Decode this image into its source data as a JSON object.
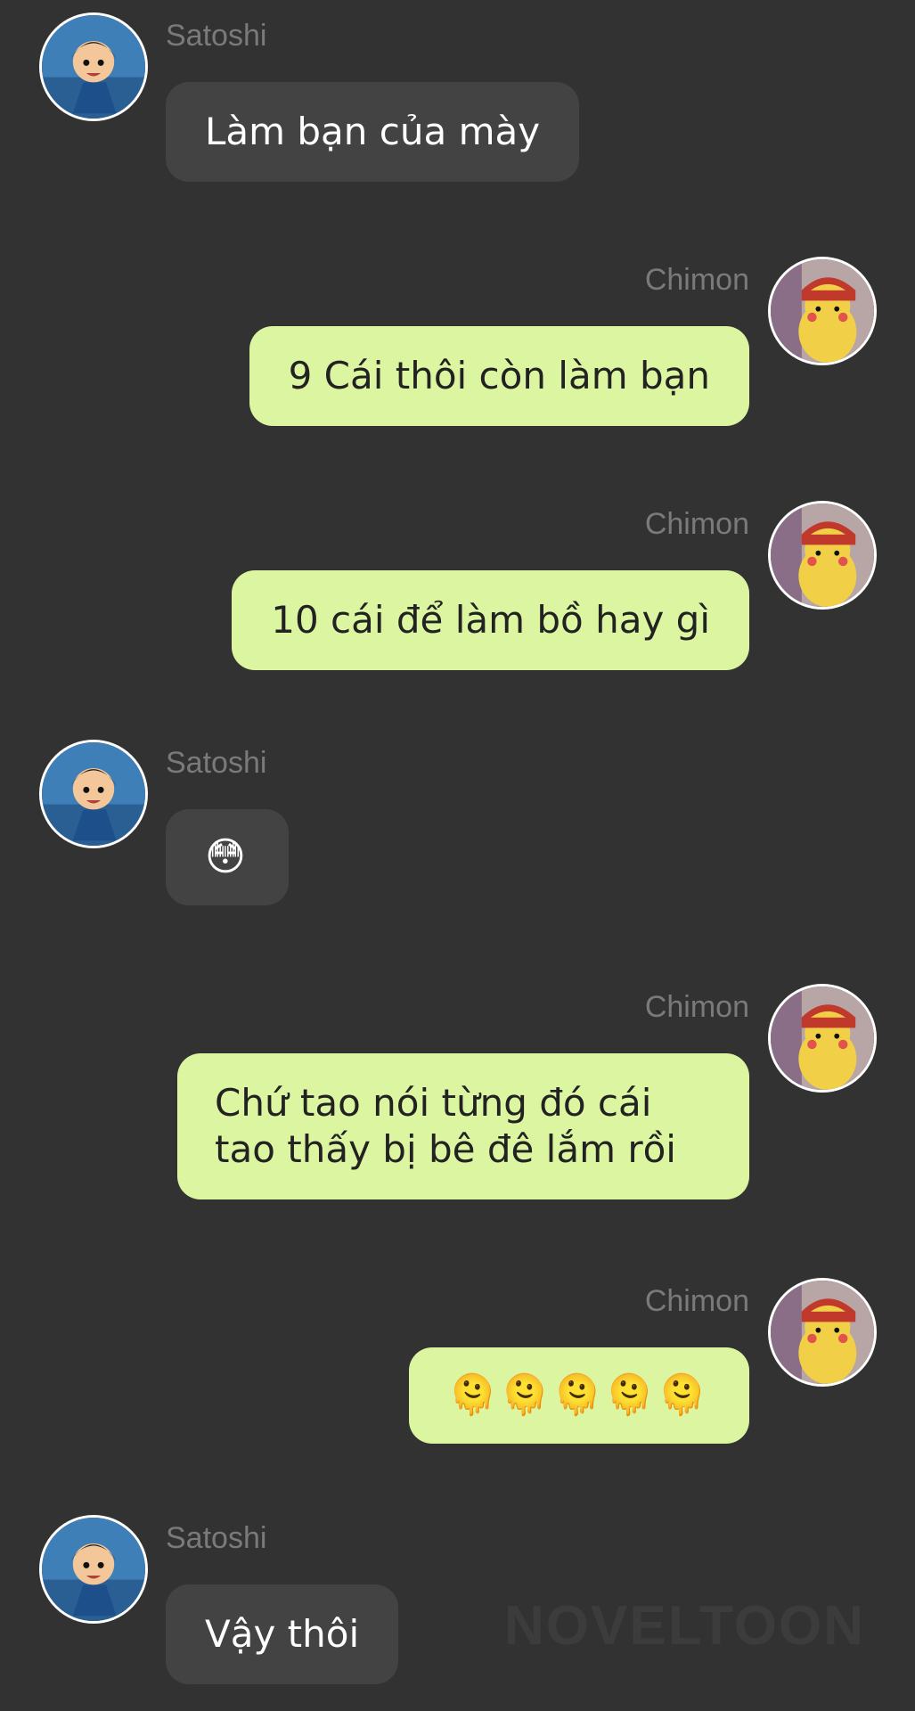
{
  "senders": {
    "satoshi": "Satoshi",
    "chimon": "Chimon"
  },
  "messages": [
    {
      "sender": "Satoshi",
      "text": "Làm bạn của mày"
    },
    {
      "sender": "Chimon",
      "text": "9 Cái thôi còn làm bạn"
    },
    {
      "sender": "Chimon",
      "text": "10 cái để làm bồ hay gì"
    },
    {
      "sender": "Satoshi",
      "text": "😳"
    },
    {
      "sender": "Chimon",
      "text": "Chứ tao nói từng đó cái tao thấy bị bê đê lắm rồi"
    },
    {
      "sender": "Chimon",
      "text": "🫠🫠🫠🫠🫠"
    },
    {
      "sender": "Satoshi",
      "text": "Vậy thôi"
    }
  ],
  "watermark": "NOVELTOON",
  "colors": {
    "background": "#323232",
    "incoming_bubble": "#434343",
    "outgoing_bubble": "#dcf5a0",
    "sender_name": "#7a7a7a"
  },
  "icons": {
    "satoshi_avatar": "ash-avatar-icon",
    "chimon_avatar": "pikachu-avatar-icon"
  }
}
